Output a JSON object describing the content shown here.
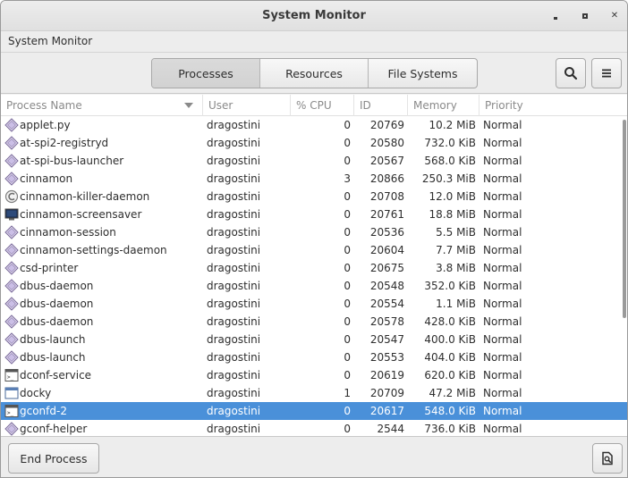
{
  "window": {
    "title": "System Monitor"
  },
  "menubar": {
    "app_menu_label": "System Monitor"
  },
  "tabs": [
    {
      "label": "Processes",
      "active": true
    },
    {
      "label": "Resources",
      "active": false
    },
    {
      "label": "File Systems",
      "active": false
    }
  ],
  "toolbar": {
    "search_icon": "search-icon",
    "menu_icon": "hamburger-menu-icon"
  },
  "table": {
    "columns": {
      "name": "Process Name",
      "user": "User",
      "cpu": "% CPU",
      "id": "ID",
      "memory": "Memory",
      "priority": "Priority"
    },
    "sort_column": "Process Name",
    "sort_direction": "descending-arrow",
    "selected_row": 16,
    "rows": [
      {
        "icon": "diamond-process-icon",
        "name": "applet.py",
        "user": "dragostini",
        "cpu": "0",
        "id": "20769",
        "memory": "10.2 MiB",
        "priority": "Normal"
      },
      {
        "icon": "diamond-process-icon",
        "name": "at-spi2-registryd",
        "user": "dragostini",
        "cpu": "0",
        "id": "20580",
        "memory": "732.0 KiB",
        "priority": "Normal"
      },
      {
        "icon": "diamond-process-icon",
        "name": "at-spi-bus-launcher",
        "user": "dragostini",
        "cpu": "0",
        "id": "20567",
        "memory": "568.0 KiB",
        "priority": "Normal"
      },
      {
        "icon": "diamond-process-icon",
        "name": "cinnamon",
        "user": "dragostini",
        "cpu": "3",
        "id": "20866",
        "memory": "250.3 MiB",
        "priority": "Normal"
      },
      {
        "icon": "cinnamon-logo-icon",
        "name": "cinnamon-killer-daemon",
        "user": "dragostini",
        "cpu": "0",
        "id": "20708",
        "memory": "12.0 MiB",
        "priority": "Normal"
      },
      {
        "icon": "screensaver-monitor-icon",
        "name": "cinnamon-screensaver",
        "user": "dragostini",
        "cpu": "0",
        "id": "20761",
        "memory": "18.8 MiB",
        "priority": "Normal"
      },
      {
        "icon": "diamond-process-icon",
        "name": "cinnamon-session",
        "user": "dragostini",
        "cpu": "0",
        "id": "20536",
        "memory": "5.5 MiB",
        "priority": "Normal"
      },
      {
        "icon": "diamond-process-icon",
        "name": "cinnamon-settings-daemon",
        "user": "dragostini",
        "cpu": "0",
        "id": "20604",
        "memory": "7.7 MiB",
        "priority": "Normal"
      },
      {
        "icon": "diamond-process-icon",
        "name": "csd-printer",
        "user": "dragostini",
        "cpu": "0",
        "id": "20675",
        "memory": "3.8 MiB",
        "priority": "Normal"
      },
      {
        "icon": "diamond-process-icon",
        "name": "dbus-daemon",
        "user": "dragostini",
        "cpu": "0",
        "id": "20548",
        "memory": "352.0 KiB",
        "priority": "Normal"
      },
      {
        "icon": "diamond-process-icon",
        "name": "dbus-daemon",
        "user": "dragostini",
        "cpu": "0",
        "id": "20554",
        "memory": "1.1 MiB",
        "priority": "Normal"
      },
      {
        "icon": "diamond-process-icon",
        "name": "dbus-daemon",
        "user": "dragostini",
        "cpu": "0",
        "id": "20578",
        "memory": "428.0 KiB",
        "priority": "Normal"
      },
      {
        "icon": "diamond-process-icon",
        "name": "dbus-launch",
        "user": "dragostini",
        "cpu": "0",
        "id": "20547",
        "memory": "400.0 KiB",
        "priority": "Normal"
      },
      {
        "icon": "diamond-process-icon",
        "name": "dbus-launch",
        "user": "dragostini",
        "cpu": "0",
        "id": "20553",
        "memory": "404.0 KiB",
        "priority": "Normal"
      },
      {
        "icon": "terminal-exec-icon",
        "name": "dconf-service",
        "user": "dragostini",
        "cpu": "0",
        "id": "20619",
        "memory": "620.0 KiB",
        "priority": "Normal"
      },
      {
        "icon": "window-app-icon",
        "name": "docky",
        "user": "dragostini",
        "cpu": "1",
        "id": "20709",
        "memory": "47.2 MiB",
        "priority": "Normal"
      },
      {
        "icon": "terminal-exec-icon",
        "name": "gconfd-2",
        "user": "dragostini",
        "cpu": "0",
        "id": "20617",
        "memory": "548.0 KiB",
        "priority": "Normal"
      },
      {
        "icon": "diamond-process-icon",
        "name": "gconf-helper",
        "user": "dragostini",
        "cpu": "0",
        "id": "2544",
        "memory": "736.0 KiB",
        "priority": "Normal"
      }
    ]
  },
  "bottombar": {
    "end_process_label": "End Process",
    "properties_icon": "process-properties-icon"
  },
  "colors": {
    "selection": "#4a90d9",
    "header_text": "#8a8a8a",
    "text": "#2e2e2e"
  }
}
